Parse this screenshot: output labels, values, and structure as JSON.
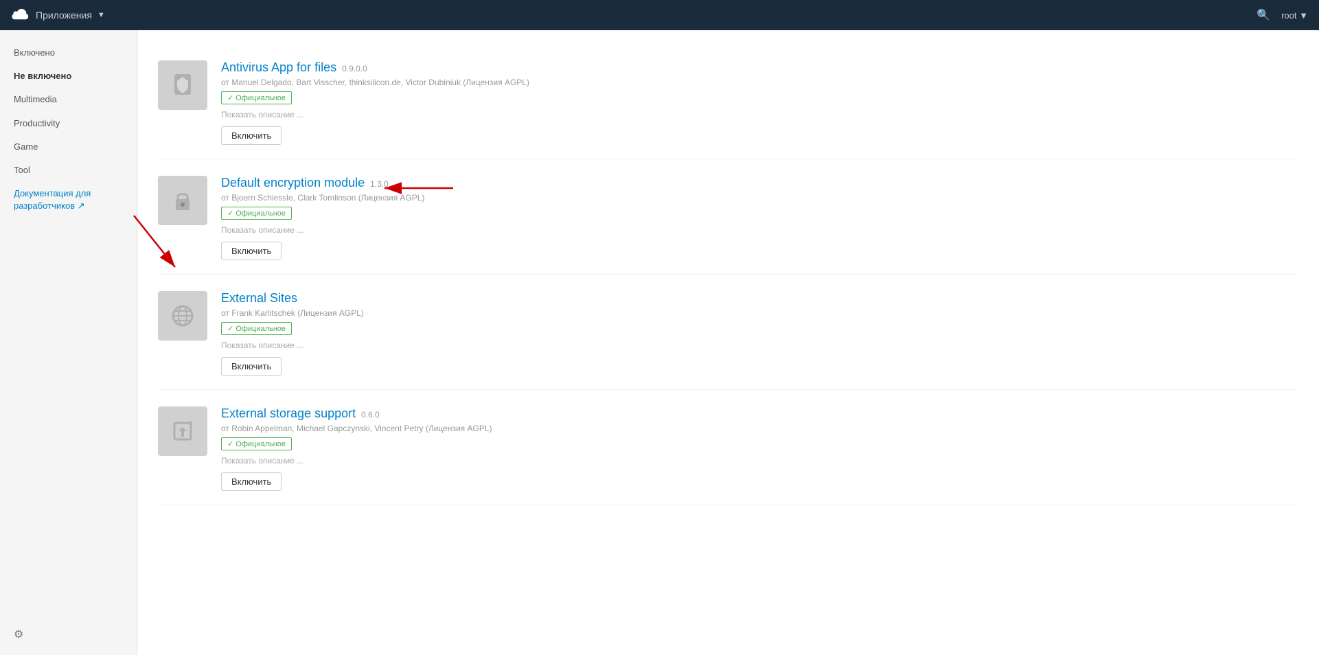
{
  "topnav": {
    "app_title": "Приложения",
    "arrow": "▼",
    "user": "root",
    "user_arrow": "▼"
  },
  "sidebar": {
    "items": [
      {
        "id": "enabled",
        "label": "Включено",
        "active": false
      },
      {
        "id": "disabled",
        "label": "Не включено",
        "active": true
      },
      {
        "id": "multimedia",
        "label": "Multimedia",
        "active": false
      },
      {
        "id": "productivity",
        "label": "Productivity",
        "active": false
      },
      {
        "id": "game",
        "label": "Game",
        "active": false
      },
      {
        "id": "tool",
        "label": "Tool",
        "active": false
      },
      {
        "id": "devdocs",
        "label": "Документация для разработчиков ↗",
        "active": false,
        "special": true
      }
    ],
    "settings_icon": "⚙"
  },
  "apps": [
    {
      "id": "antivirus",
      "name": "Antivirus App for files",
      "version": "0.9.0.0",
      "author": "от Manuel Delgado, Bart Visscher, thinksilicon.de, Victor Dubiniuk (Лицензия AGPL)",
      "official_label": "✓ Официальное",
      "show_description": "Показать описание ...",
      "enable_label": "Включить",
      "icon": "🛡"
    },
    {
      "id": "encryption",
      "name": "Default encryption module",
      "version": "1.3.0",
      "author": "от Bjoern Schiessle, Clark Tomlinson (Лицензия AGPL)",
      "official_label": "✓ Официальное",
      "show_description": "Показать описание ...",
      "enable_label": "Включить",
      "icon": "🔒"
    },
    {
      "id": "external-sites",
      "name": "External Sites",
      "version": "",
      "author": "от Frank Karlitschek (Лицензия AGPL)",
      "official_label": "✓ Официальное",
      "show_description": "Показать описание ...",
      "enable_label": "Включить",
      "icon": "🌐"
    },
    {
      "id": "external-storage",
      "name": "External storage support",
      "version": "0.6.0",
      "author": "от Robin Appelman, Michael Gapczynski, Vincent Petry (Лицензия AGPL)",
      "official_label": "✓ Официальное",
      "show_description": "Показать описание ...",
      "enable_label": "Включить",
      "icon": "↗"
    }
  ]
}
